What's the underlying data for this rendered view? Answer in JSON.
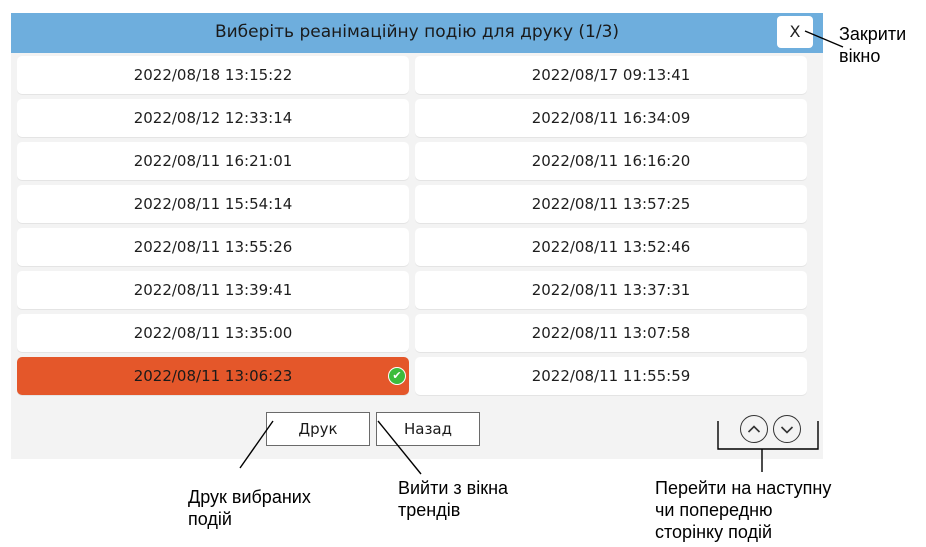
{
  "dialog": {
    "title": "Виберіть реанімаційну подію для друку (1/3)",
    "close_label": "X"
  },
  "events": [
    {
      "left": "2022/08/18 13:15:22",
      "right": "2022/08/17 09:13:41"
    },
    {
      "left": "2022/08/12 12:33:14",
      "right": "2022/08/11 16:34:09"
    },
    {
      "left": "2022/08/11 16:21:01",
      "right": "2022/08/11 16:16:20"
    },
    {
      "left": "2022/08/11 15:54:14",
      "right": "2022/08/11 13:57:25"
    },
    {
      "left": "2022/08/11 13:55:26",
      "right": "2022/08/11 13:52:46"
    },
    {
      "left": "2022/08/11 13:39:41",
      "right": "2022/08/11 13:37:31"
    },
    {
      "left": "2022/08/11 13:35:00",
      "right": "2022/08/11 13:07:58"
    },
    {
      "left": "2022/08/11 13:06:23",
      "right": "2022/08/11 11:55:59"
    }
  ],
  "selected_event": "2022/08/11 13:06:23",
  "buttons": {
    "print": "Друк",
    "back": "Назад"
  },
  "paging": {
    "up_icon": "chevron-up-circle-icon",
    "down_icon": "chevron-down-circle-icon"
  },
  "callouts": {
    "close_line1": "Закрити",
    "close_line2": "вікно",
    "print_line1": "Друк вибраних",
    "print_line2": "подій",
    "back_line1": "Вийти з вікна",
    "back_line2": "трендів",
    "page_line1": "Перейти на наступну",
    "page_line2": "чи попередню",
    "page_line3": "сторінку подій"
  },
  "colors": {
    "header": "#6eaedd",
    "selected": "#e4572a",
    "check": "#3cbc3c"
  }
}
